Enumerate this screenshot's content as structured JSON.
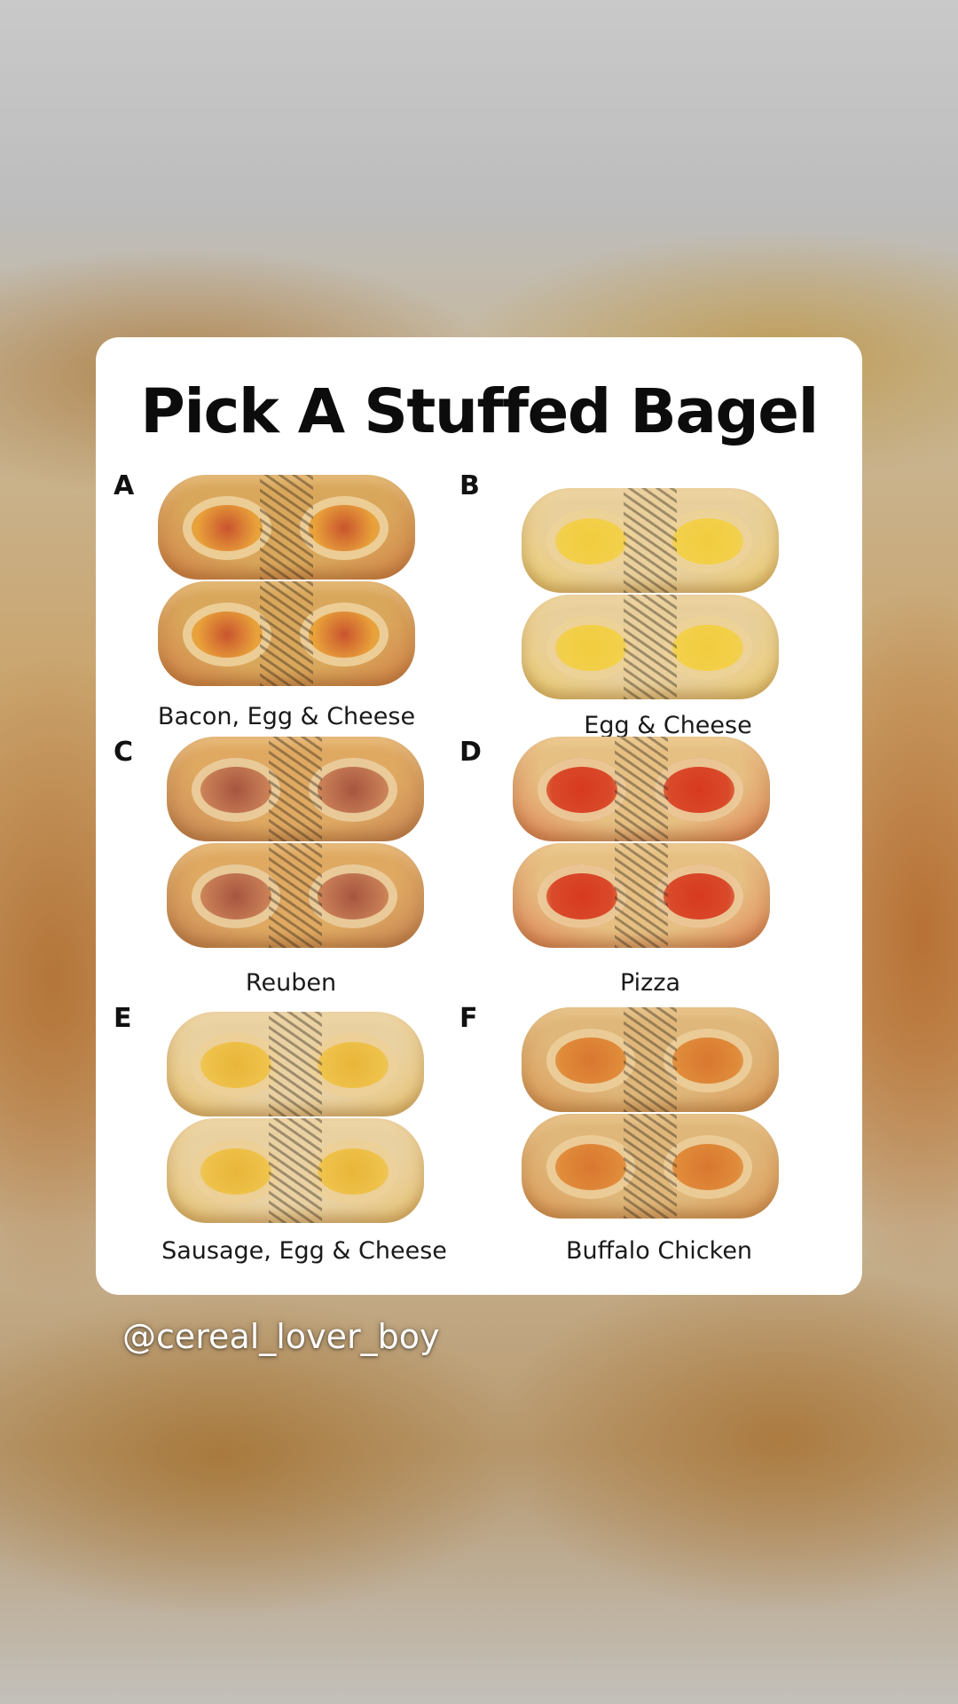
{
  "post": {
    "title": "Pick A Stuffed Bagel",
    "handle": "@cereal_lover_boy",
    "options": [
      {
        "letter": "A",
        "label": "Bacon, Egg & Cheese",
        "crust": "#d9a75c",
        "filling": "#c9542e",
        "pocket_fill": "#e9a23a"
      },
      {
        "letter": "B",
        "label": "Egg & Cheese",
        "crust": "#e8cf9b",
        "filling": "#f1cc3f",
        "pocket_fill": "#f3d04a"
      },
      {
        "letter": "C",
        "label": "Reuben",
        "crust": "#dfa962",
        "filling": "#a7553f",
        "pocket_fill": "#c77d55"
      },
      {
        "letter": "D",
        "label": "Pizza",
        "crust": "#e6c083",
        "filling": "#d8391f",
        "pocket_fill": "#d94a2a"
      },
      {
        "letter": "E",
        "label": "Sausage, Egg & Cheese",
        "crust": "#e9d1a2",
        "filling": "#e8b63a",
        "pocket_fill": "#efc24a"
      },
      {
        "letter": "F",
        "label": "Buffalo Chicken",
        "crust": "#dfb77a",
        "filling": "#d9772f",
        "pocket_fill": "#e08b3a"
      }
    ]
  }
}
